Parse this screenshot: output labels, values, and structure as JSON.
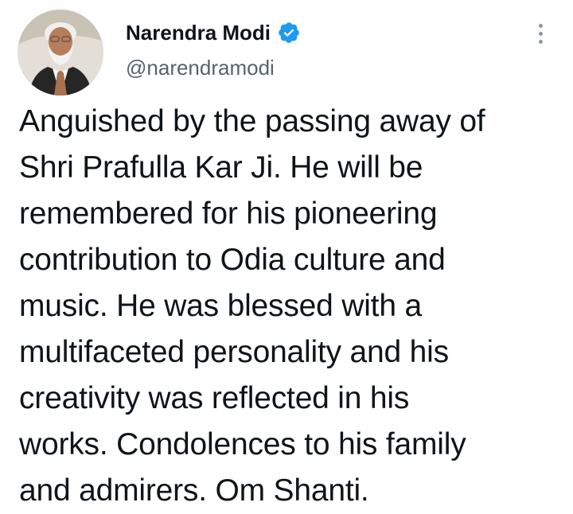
{
  "tweet": {
    "author": {
      "name": "Narendra Modi",
      "handle": "@narendramodi",
      "verified": true,
      "avatar_icon": "profile-photo",
      "verified_icon": "verified-badge-icon"
    },
    "more_icon": "more-options-icon",
    "text_lines": [
      "Anguished by the passing away of",
      "Shri Prafulla Kar Ji. He will be",
      "remembered for his pioneering",
      "contribution to Odia culture and",
      "music. He was blessed with a",
      "multifaceted personality and his",
      "creativity was reflected in his",
      "works. Condolences to his family",
      "and admirers. Om Shanti."
    ]
  },
  "colors": {
    "text": "#0f1419",
    "secondary_text": "#536471",
    "verified_blue": "#1d9bf0",
    "more_dots": "#8899a6",
    "background": "#ffffff"
  }
}
